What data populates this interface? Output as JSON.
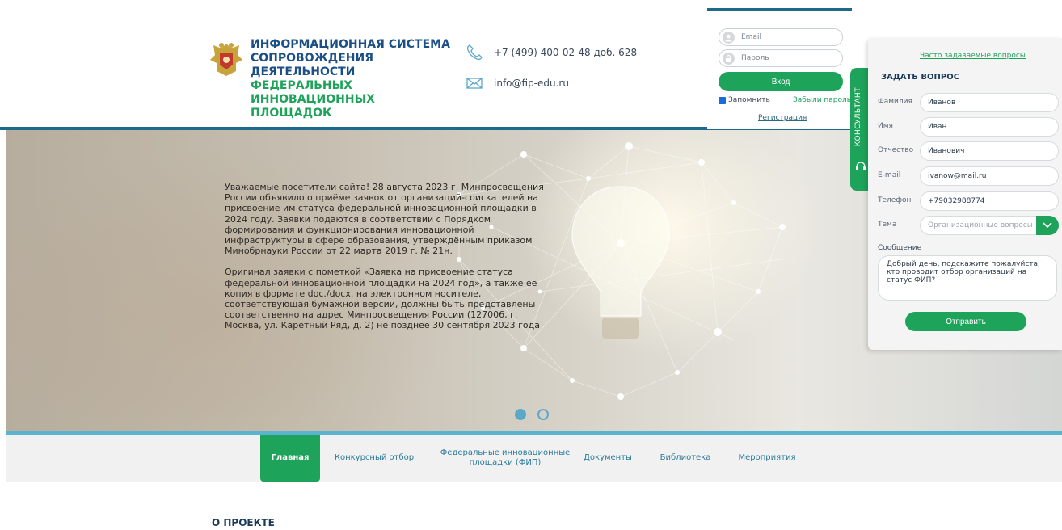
{
  "header": {
    "title_line1": "ИНФОРМАЦИОННАЯ СИСТЕМА",
    "title_line2": "СОПРОВОЖДЕНИЯ ДЕЯТЕЛЬНОСТИ",
    "title_line3": "ФЕДЕРАЛЬНЫХ ИННОВАЦИОННЫХ",
    "title_line4": "ПЛОЩАДОК",
    "phone": "+7 (499) 400-02-48 доб. 628",
    "email": "info@fip-edu.ru"
  },
  "login": {
    "email_placeholder": "Email",
    "password_placeholder": "Пароль",
    "login_button": "Вход",
    "remember_label": "Запомнить",
    "forgot_link": "Забыли пароль",
    "register_link": "Регистрация"
  },
  "hero": {
    "paragraph1": "Уважаемые посетители сайта! 28 августа 2023 г. Минпросвещения России объявило о приёме заявок от организаций-соискателей на присвоение им статуса федеральной инновационной площадки в 2024 году. Заявки подаются в соответствии с Порядком формирования и функционирования инновационной инфраструктуры в сфере образования, утверждённым приказом Минобрнауки России от 22 марта 2019 г. № 21н.",
    "paragraph2": "Оригинал заявки с пометкой «Заявка на присвоение статуса федеральной инновационной площадки на 2024 год», а также её копия в формате doc./docx. на электронном носителе, соответствующая бумажной версии, должны быть представлены соответственно на адрес Минпросвещения России (127006, г. Москва, ул. Каретный Ряд, д. 2) не позднее 30 сентября 2023 года",
    "slide_active": 1,
    "slide_count": 2
  },
  "nav": {
    "items": [
      {
        "label": "Главная",
        "active": true
      },
      {
        "label": "Конкурсный отбор"
      },
      {
        "label": "Федеральные инновационные площадки (ФИП)"
      },
      {
        "label": "Документы"
      },
      {
        "label": "Библиотека"
      },
      {
        "label": "Мероприятия"
      }
    ]
  },
  "section": {
    "about_title": "О ПРОЕКТЕ"
  },
  "consultant": {
    "tab_label": "КОНСУЛЬТАНТ",
    "faq_link": "Часто задаваемые вопросы",
    "title": "ЗАДАТЬ ВОПРОС",
    "fields": [
      {
        "label": "Фамилия",
        "value": "Иванов"
      },
      {
        "label": "Имя",
        "value": "Иван"
      },
      {
        "label": "Отчество",
        "value": "Иванович"
      },
      {
        "label": "E-mail",
        "value": "ivanow@mail.ru"
      },
      {
        "label": "Телефон",
        "value": "+79032988774"
      },
      {
        "label": "Тема",
        "placeholder": "Организационные вопросы"
      }
    ],
    "message_label": "Сообщение",
    "message_text": "Добрый день, подскажите пожалуйста, кто проводит отбор организаций на статус ФИП?",
    "send_button": "Отправить"
  },
  "colors": {
    "accent_green": "#1ea35a",
    "header_blue": "#1d6b8a",
    "title_blue": "#1b4f86",
    "nav_link": "#2a7a9a"
  },
  "icons": [
    "emblem-icon",
    "phone-icon",
    "mail-icon",
    "user-icon",
    "lock-icon",
    "chevron-down-icon",
    "consultant-icon"
  ]
}
